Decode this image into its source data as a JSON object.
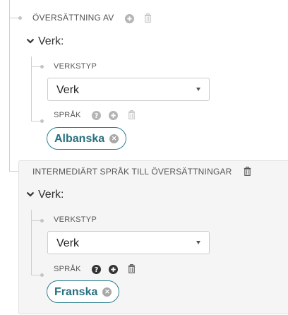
{
  "section1": {
    "label": "ÖVERSÄTTNING AV",
    "heading": "Verk:",
    "verkstyp_label": "VERKSTYP",
    "verkstyp_value": "Verk",
    "sprak_label": "SPRÅK",
    "sprak_tag": "Albanska"
  },
  "section2": {
    "label": "INTERMEDIÄRT SPRÅK TILL ÖVERSÄTTNINGAR",
    "heading": "Verk:",
    "verkstyp_label": "VERKSTYP",
    "verkstyp_value": "Verk",
    "sprak_label": "SPRÅK",
    "sprak_tag": "Franska"
  },
  "icons": {
    "add": "plus-circle-icon",
    "delete": "trash-icon",
    "help": "question-circle-icon",
    "remove_tag": "times-circle-icon",
    "expand": "chevron-down-icon"
  }
}
